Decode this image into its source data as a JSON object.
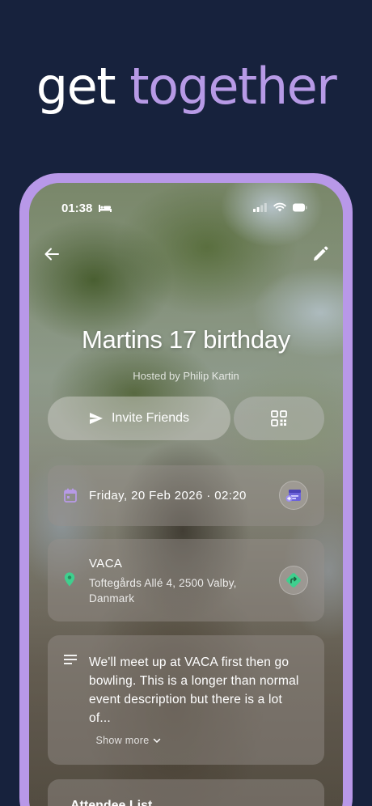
{
  "headline": {
    "word1": "get",
    "word2": "together"
  },
  "status_bar": {
    "time": "01:38"
  },
  "event": {
    "title": "Martins 17 birthday",
    "hosted_by": "Hosted by Philip Kartin"
  },
  "actions": {
    "invite_label": "Invite Friends"
  },
  "date_card": {
    "text": "Friday, 20 Feb 2026 · 02:20"
  },
  "location_card": {
    "venue": "VACA",
    "address": "Toftegårds Allé 4, 2500 Valby, Danmark"
  },
  "description_card": {
    "text": "We'll meet up at VACA first then go bowling. This is a longer than normal event description but there is a lot of...",
    "show_more": "Show more"
  },
  "attendees_card": {
    "title": "Attendee List"
  },
  "colors": {
    "background": "#17223d",
    "accent": "#b898e8",
    "date_icon": "#b79ae6",
    "pin_icon": "#3fcf8e"
  }
}
